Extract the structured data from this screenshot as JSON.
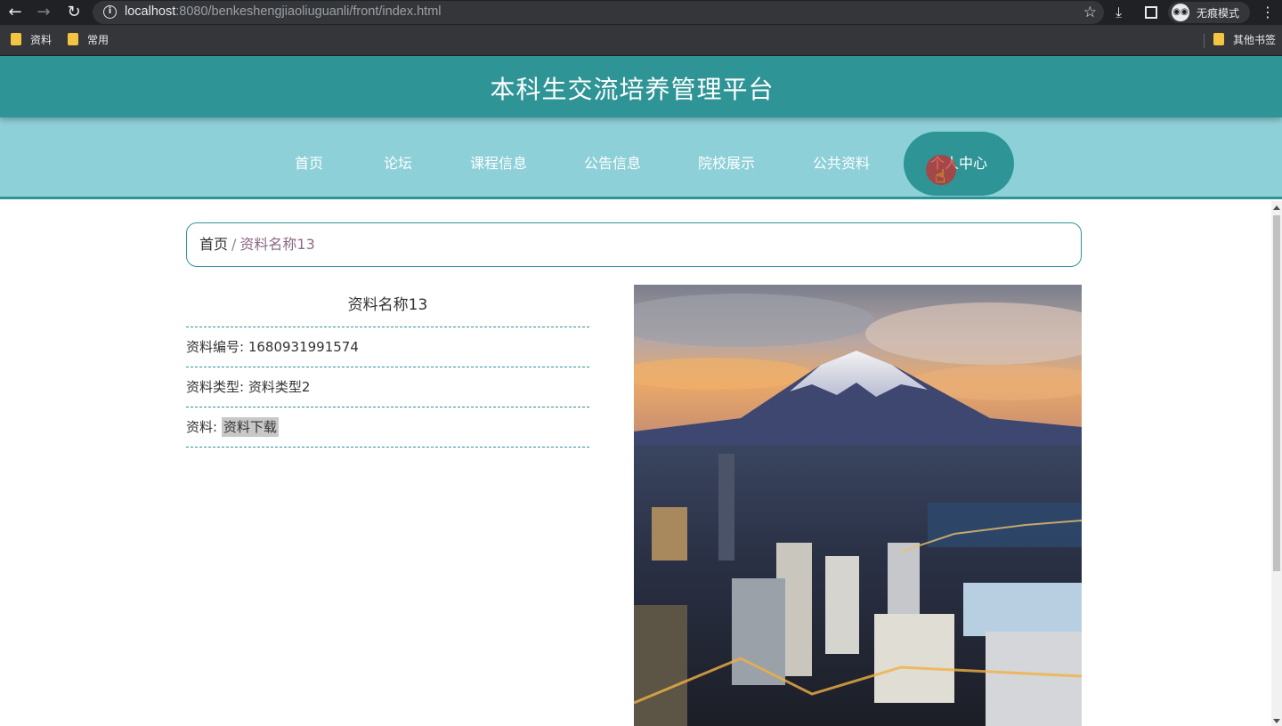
{
  "browser": {
    "url_host": "localhost",
    "url_rest": ":8080/benkeshengjiaoliuguanli/front/index.html",
    "incognito_label": "无痕模式",
    "bookmarks": [
      "资料",
      "常用"
    ],
    "other_bookmarks": "其他书签"
  },
  "site": {
    "title": "本科生交流培养管理平台",
    "nav": [
      "首页",
      "论坛",
      "课程信息",
      "公告信息",
      "院校展示",
      "公共资料",
      "个人中心"
    ]
  },
  "breadcrumb": {
    "home": "首页",
    "separator": "/",
    "current": "资料名称13"
  },
  "detail": {
    "title": "资料名称13",
    "number_label": "资料编号: ",
    "number_value": "1680931991574",
    "type_label": "资料类型: ",
    "type_value": "资料类型2",
    "file_label": "资料: ",
    "file_link": "资料下载"
  },
  "colors": {
    "header": "#2e9496",
    "nav": "#8dd0d8"
  }
}
